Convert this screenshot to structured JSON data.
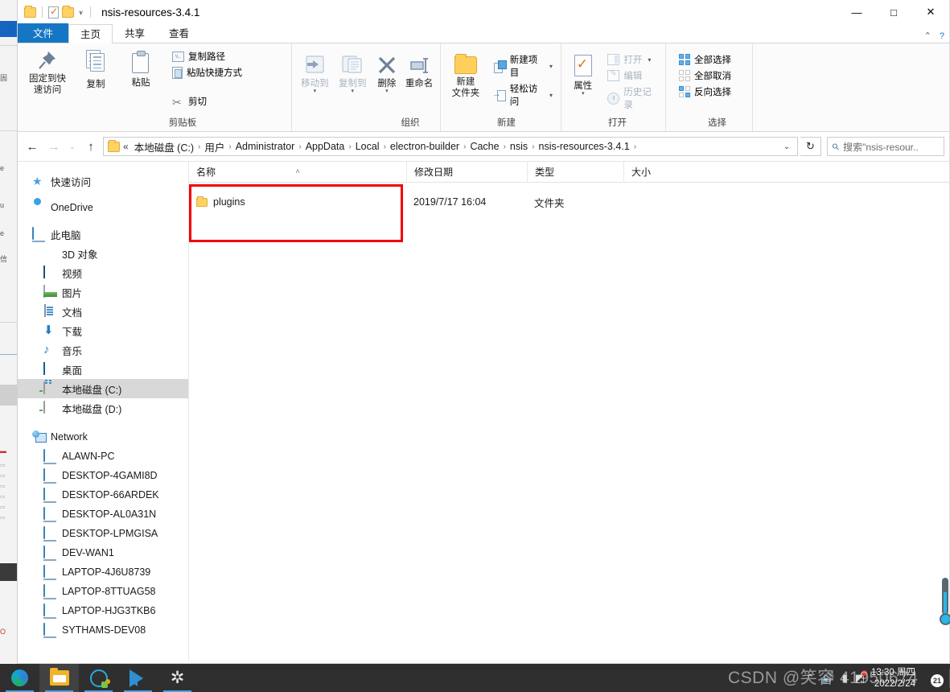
{
  "window": {
    "title": "nsis-resources-3.4.1",
    "quick_access_toolbar": [
      {
        "name": "properties-qat",
        "icon": "properties-icon"
      },
      {
        "name": "new-folder-qat",
        "icon": "folder-icon"
      }
    ],
    "controls": {
      "minimize": "—",
      "maximize": "□",
      "close": "✕"
    }
  },
  "ribbon": {
    "tabs": [
      {
        "id": "file",
        "label": "文件",
        "active": false,
        "special": true
      },
      {
        "id": "home",
        "label": "主页",
        "active": true,
        "special": false
      },
      {
        "id": "share",
        "label": "共享",
        "active": false,
        "special": false
      },
      {
        "id": "view",
        "label": "查看",
        "active": false,
        "special": false
      }
    ],
    "collapse_icon": "⌃",
    "help_icon": "?",
    "groups": [
      {
        "id": "clipboard",
        "label": "剪贴板",
        "big_buttons": [
          {
            "id": "pin-to-quick-access",
            "label": "固定到快\n速访问",
            "line1": "固定到快",
            "line2": "速访问",
            "icon": "pin-icon"
          },
          {
            "id": "copy",
            "label": "复制",
            "icon": "copy-icon"
          },
          {
            "id": "paste",
            "label": "粘贴",
            "icon": "paste-icon"
          }
        ],
        "small_buttons": [
          {
            "id": "copy-path",
            "label": "复制路径",
            "icon": "copy-path-icon"
          },
          {
            "id": "paste-shortcut",
            "label": "粘贴快捷方式",
            "icon": "paste-shortcut-icon"
          },
          {
            "id": "cut",
            "label": "剪切",
            "icon": "scissors-icon"
          }
        ]
      },
      {
        "id": "organize",
        "label": "组织",
        "big_buttons": [
          {
            "id": "move-to",
            "label": "移动到",
            "icon": "move-to-icon",
            "has_caret": true,
            "disabled": true
          },
          {
            "id": "copy-to",
            "label": "复制到",
            "icon": "copy-to-icon",
            "has_caret": true,
            "disabled": true
          },
          {
            "id": "delete",
            "label": "删除",
            "icon": "delete-x-icon",
            "has_caret": true
          },
          {
            "id": "rename",
            "label": "重命名",
            "icon": "rename-icon"
          }
        ]
      },
      {
        "id": "new",
        "label": "新建",
        "big_buttons": [
          {
            "id": "new-folder",
            "line1": "新建",
            "line2": "文件夹",
            "label": "新建文件夹",
            "icon": "new-folder-icon"
          }
        ],
        "small_buttons": [
          {
            "id": "new-item",
            "label": "新建项目",
            "icon": "new-item-icon",
            "has_caret": true
          },
          {
            "id": "easy-access",
            "label": "轻松访问",
            "icon": "easy-access-icon",
            "has_caret": true
          }
        ]
      },
      {
        "id": "open",
        "label": "打开",
        "big_buttons": [
          {
            "id": "properties",
            "label": "属性",
            "icon": "properties-icon",
            "has_caret": true
          }
        ],
        "small_buttons": [
          {
            "id": "open",
            "label": "打开",
            "icon": "open-icon",
            "has_caret": true,
            "disabled": true
          },
          {
            "id": "edit",
            "label": "编辑",
            "icon": "edit-icon",
            "disabled": true
          },
          {
            "id": "history",
            "label": "历史记录",
            "icon": "history-icon",
            "disabled": true
          }
        ]
      },
      {
        "id": "select",
        "label": "选择",
        "small_buttons": [
          {
            "id": "select-all",
            "label": "全部选择",
            "icon": "select-all-icon"
          },
          {
            "id": "select-none",
            "label": "全部取消",
            "icon": "select-none-icon"
          },
          {
            "id": "invert-selection",
            "label": "反向选择",
            "icon": "invert-selection-icon"
          }
        ]
      }
    ]
  },
  "addressbar": {
    "back_icon": "←",
    "forward_icon": "→",
    "recent_icon": "⌄",
    "up_icon": "↑",
    "root_prefix": "«",
    "crumbs": [
      "本地磁盘 (C:)",
      "用户",
      "Administrator",
      "AppData",
      "Local",
      "electron-builder",
      "Cache",
      "nsis",
      "nsis-resources-3.4.1"
    ],
    "separator": "›",
    "dropdown_icon": "⌄",
    "refresh_icon": "↻",
    "search_icon": "search-icon",
    "search_placeholder": "搜索\"nsis-resour.."
  },
  "navpane": {
    "items": [
      {
        "id": "quick-access",
        "label": "快速访问",
        "icon": "star-icon",
        "level": 1,
        "selected": false
      },
      {
        "id": "onedrive",
        "label": "OneDrive",
        "icon": "cloud-icon",
        "level": 1,
        "selected": false
      },
      {
        "id": "this-pc",
        "label": "此电脑",
        "icon": "pc-icon",
        "level": 1,
        "selected": false
      },
      {
        "id": "3d-objects",
        "label": "3D 对象",
        "icon": "3d-objects-icon",
        "level": 2,
        "selected": false
      },
      {
        "id": "videos",
        "label": "视频",
        "icon": "video-icon",
        "level": 2,
        "selected": false
      },
      {
        "id": "pictures",
        "label": "图片",
        "icon": "picture-icon",
        "level": 2,
        "selected": false
      },
      {
        "id": "documents",
        "label": "文档",
        "icon": "document-icon",
        "level": 2,
        "selected": false
      },
      {
        "id": "downloads",
        "label": "下载",
        "icon": "download-icon",
        "level": 2,
        "selected": false
      },
      {
        "id": "music",
        "label": "音乐",
        "icon": "music-icon",
        "level": 2,
        "selected": false
      },
      {
        "id": "desktop",
        "label": "桌面",
        "icon": "desktop-icon",
        "level": 2,
        "selected": false
      },
      {
        "id": "local-disk-c",
        "label": "本地磁盘 (C:)",
        "icon": "system-drive-icon",
        "level": 2,
        "selected": true
      },
      {
        "id": "local-disk-d",
        "label": "本地磁盘 (D:)",
        "icon": "drive-icon",
        "level": 2,
        "selected": false
      },
      {
        "id": "network",
        "label": "Network",
        "icon": "network-icon",
        "level": 1,
        "selected": false,
        "spacer_before": true
      },
      {
        "id": "alawn-pc",
        "label": "ALAWN-PC",
        "icon": "monitor-icon",
        "level": 2,
        "selected": false
      },
      {
        "id": "desktop-4gami8d",
        "label": "DESKTOP-4GAMI8D",
        "icon": "monitor-icon",
        "level": 2,
        "selected": false
      },
      {
        "id": "desktop-66ardek",
        "label": "DESKTOP-66ARDEK",
        "icon": "monitor-icon",
        "level": 2,
        "selected": false
      },
      {
        "id": "desktop-al0a31n",
        "label": "DESKTOP-AL0A31N",
        "icon": "monitor-icon",
        "level": 2,
        "selected": false
      },
      {
        "id": "desktop-lpmgisa",
        "label": "DESKTOP-LPMGISA",
        "icon": "monitor-icon",
        "level": 2,
        "selected": false
      },
      {
        "id": "dev-wan1",
        "label": "DEV-WAN1",
        "icon": "monitor-icon",
        "level": 2,
        "selected": false
      },
      {
        "id": "laptop-4j6u8739",
        "label": "LAPTOP-4J6U8739",
        "icon": "monitor-icon",
        "level": 2,
        "selected": false
      },
      {
        "id": "laptop-8ttuag58",
        "label": "LAPTOP-8TTUAG58",
        "icon": "monitor-icon",
        "level": 2,
        "selected": false
      },
      {
        "id": "laptop-hjg3tkb6",
        "label": "LAPTOP-HJG3TKB6",
        "icon": "monitor-icon",
        "level": 2,
        "selected": false
      },
      {
        "id": "sythams-dev08",
        "label": "SYTHAMS-DEV08",
        "icon": "monitor-icon",
        "level": 2,
        "selected": false
      }
    ]
  },
  "filelist": {
    "columns": [
      {
        "id": "name",
        "label": "名称",
        "sorted": true,
        "sort_caret": "˄"
      },
      {
        "id": "date",
        "label": "修改日期",
        "sorted": false
      },
      {
        "id": "type",
        "label": "类型",
        "sorted": false
      },
      {
        "id": "size",
        "label": "大小",
        "sorted": false
      }
    ],
    "rows": [
      {
        "name": "plugins",
        "date": "2019/7/17 16:04",
        "type": "文件夹",
        "size": "",
        "icon": "folder-icon"
      }
    ],
    "highlight_color": "#f40000"
  },
  "taskbar": {
    "items": [
      {
        "id": "edge",
        "label": "Microsoft Edge",
        "icon": "edge-icon",
        "active": false,
        "running": true
      },
      {
        "id": "file-explorer",
        "label": "文件资源管理器",
        "icon": "file-explorer-icon",
        "active": true,
        "running": true
      },
      {
        "id": "chat",
        "label": "Chat",
        "icon": "chat-icon",
        "active": false,
        "running": true
      },
      {
        "id": "vscode",
        "label": "Visual Studio Code",
        "icon": "vscode-icon",
        "active": false,
        "running": true
      },
      {
        "id": "settings",
        "label": "设置",
        "icon": "gear-icon",
        "active": false,
        "running": true
      }
    ],
    "tray": {
      "icons": [
        {
          "id": "hidden-icons",
          "icon": "chevron-up-icon"
        },
        {
          "id": "sound",
          "icon": "speaker-muted-icon"
        },
        {
          "id": "network",
          "icon": "network-icon"
        },
        {
          "id": "app-tray",
          "icon": "app-icon",
          "has_badge": true
        }
      ],
      "clock_time": "13:30 周四",
      "clock_date": "2022/2/24",
      "action_center_badge": "21"
    }
  },
  "watermark": {
    "text": "CSDN @笑容 41950674"
  }
}
